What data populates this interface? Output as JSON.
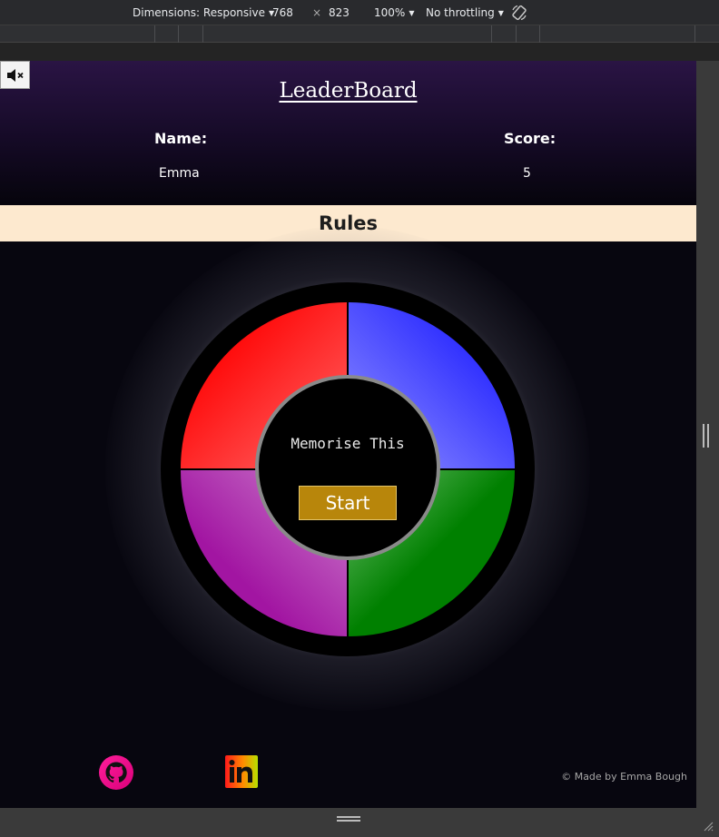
{
  "devtools": {
    "dimensions_label": "Dimensions: Responsive",
    "width": "768",
    "times": "×",
    "height": "823",
    "zoom": "100%",
    "throttling": "No throttling",
    "caret": "▼"
  },
  "leaderboard": {
    "title": "LeaderBoard",
    "name_header": "Name:",
    "score_header": "Score:",
    "entries": [
      {
        "name": "Emma",
        "score": "5"
      }
    ]
  },
  "rules": {
    "label": "Rules"
  },
  "game": {
    "prompt": "Memorise This",
    "start_label": "Start",
    "colors": {
      "red": "#ff0000",
      "blue": "#1e1eff",
      "purple": "#a215a2",
      "green": "#008000",
      "start": "#b8860b"
    }
  },
  "footer": {
    "copyright": "© Made by Emma Bough",
    "icons": [
      "github-icon",
      "linkedin-icon"
    ]
  },
  "icons": {
    "mute": "speaker-muted-icon"
  }
}
